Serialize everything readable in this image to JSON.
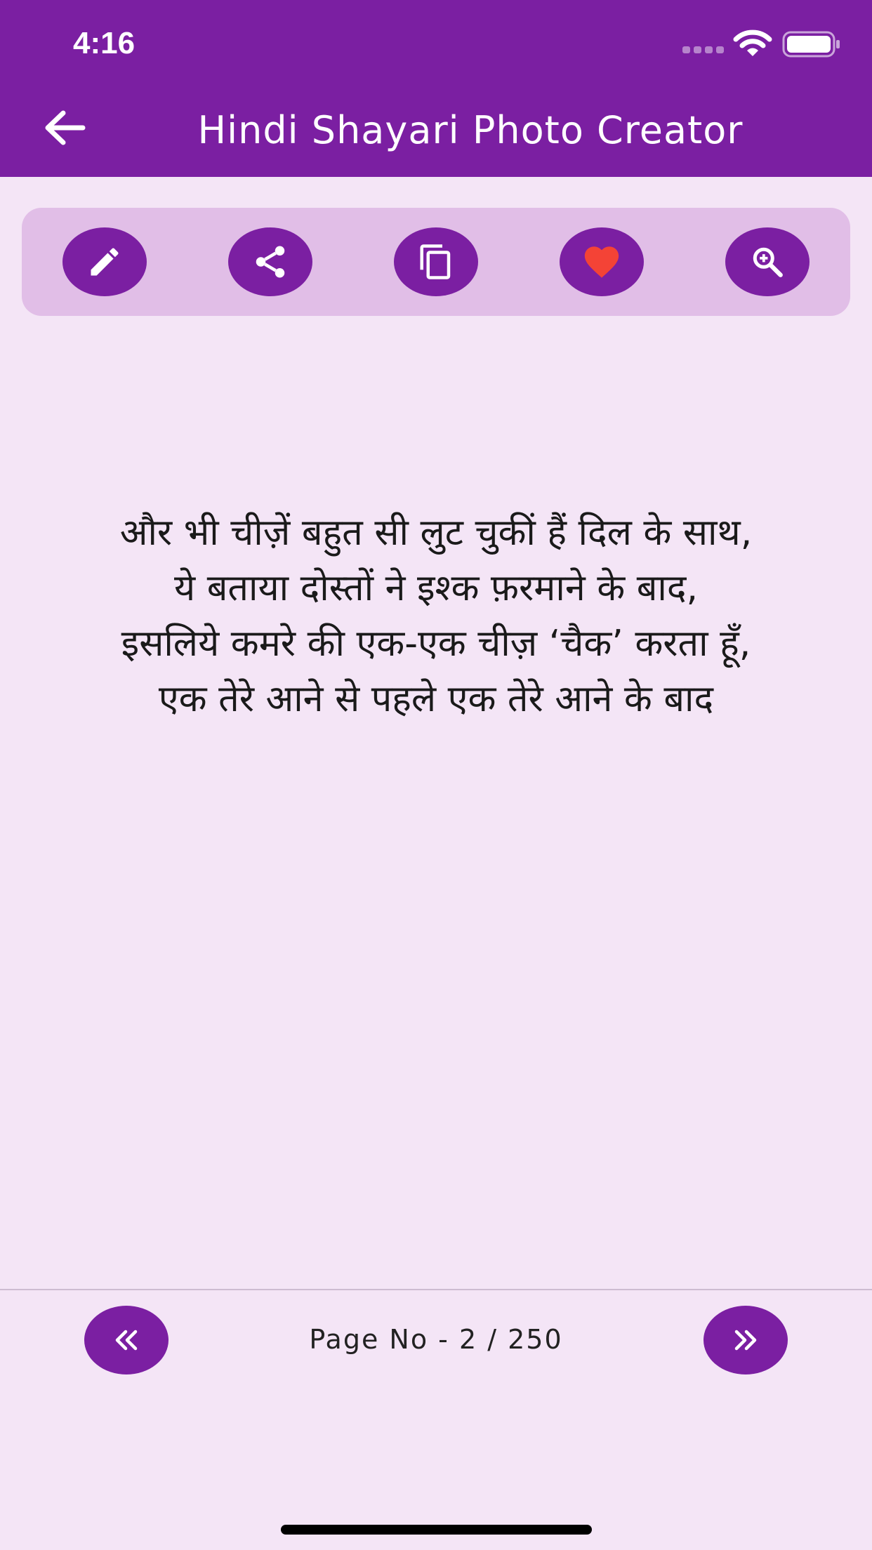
{
  "status_bar": {
    "time": "4:16"
  },
  "header": {
    "title": "Hindi Shayari Photo Creator",
    "back_icon": "arrow-left-icon"
  },
  "toolbar": {
    "buttons": [
      {
        "name": "edit",
        "icon": "pencil-icon"
      },
      {
        "name": "share",
        "icon": "share-icon"
      },
      {
        "name": "copy",
        "icon": "copy-icon"
      },
      {
        "name": "favorite",
        "icon": "heart-icon"
      },
      {
        "name": "zoom",
        "icon": "zoom-in-icon"
      }
    ]
  },
  "content": {
    "shayari": "और भी चीज़ें बहुत सी लुट चुकीं हैं दिल के साथ,\nये बताया दोस्तों ने इश्क फ़रमाने के बाद,\nइसलिये कमरे की एक-एक चीज़ ‘चैक’ करता हूँ,\nएक तेरे आने से पहले एक तेरे आने के बाद"
  },
  "pagination": {
    "label": "Page No - 2 / 250",
    "prev_icon": "chevron-double-left-icon",
    "next_icon": "chevron-double-right-icon"
  },
  "colors": {
    "primary": "#7b1fa2",
    "toolbar_bg": "#e1bee7",
    "page_bg": "#f4e5f6",
    "heart": "#f44336"
  }
}
